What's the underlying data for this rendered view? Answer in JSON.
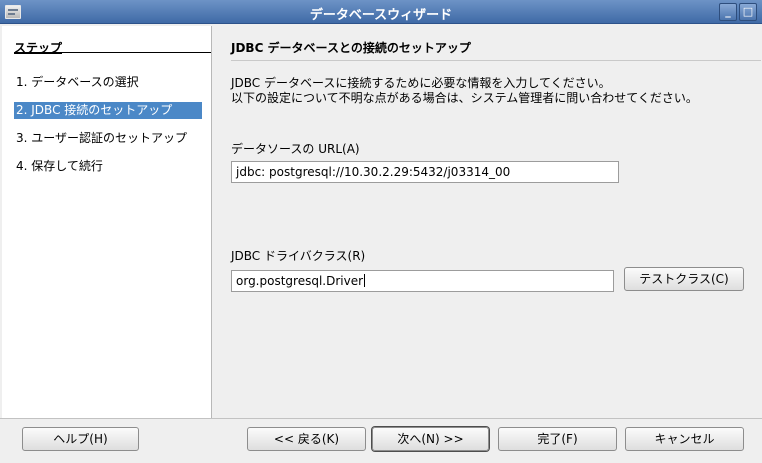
{
  "window": {
    "title": "データベースウィザード",
    "minimize_label": "_",
    "maximize_label": "□",
    "close_label": "×"
  },
  "steps": {
    "heading": "ステップ",
    "items": [
      {
        "label": "1. データベースの選択"
      },
      {
        "label": "2. JDBC 接続のセットアップ"
      },
      {
        "label": "3. ユーザー認証のセットアップ"
      },
      {
        "label": "4. 保存して続行"
      }
    ]
  },
  "page": {
    "heading": "JDBC データベースとの接続のセットアップ",
    "description_line1": "JDBC データベースに接続するために必要な情報を入力してください。",
    "description_line2": "以下の設定について不明な点がある場合は、システム管理者に問い合わせてください。",
    "url_label": "データソースの URL(A)",
    "url_prefix": "jdbc:",
    "url_value": "postgresql://10.30.2.29:5432/j03314_00",
    "driver_label": "JDBC ドライバクラス(R)",
    "driver_value": "org.postgresql.Driver",
    "test_class_button": "テストクラス(C)"
  },
  "footer": {
    "help_button": "ヘルプ(H)",
    "back_button": "<< 戻る(K)",
    "next_button": "次へ(N) >>",
    "finish_button": "完了(F)",
    "cancel_button": "キャンセル"
  },
  "colors": {
    "selection": "#4b88c7",
    "titlebar": "#4f79b3"
  }
}
